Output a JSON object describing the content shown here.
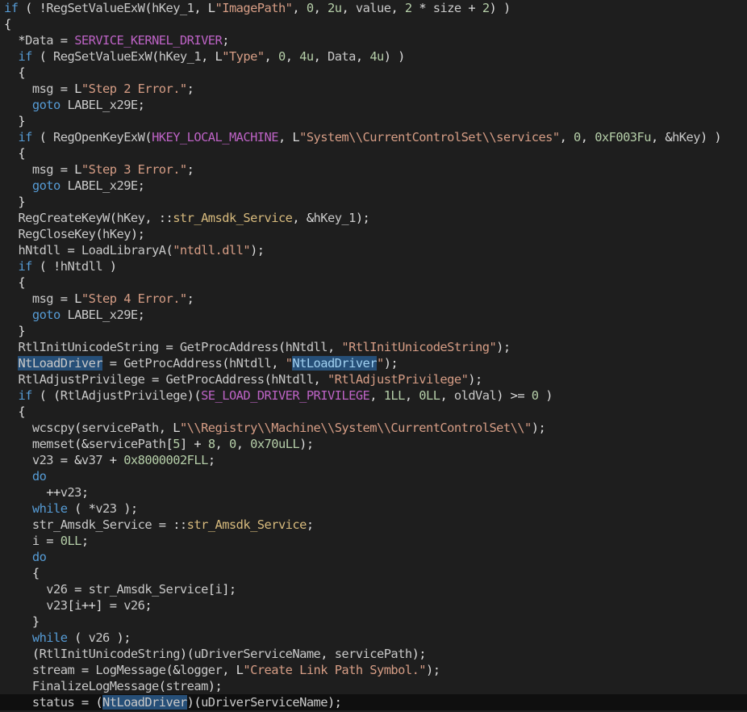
{
  "editor": {
    "name": "decompiled-pseudocode",
    "lines": [
      [
        [
          "if",
          "k"
        ],
        [
          " ( !",
          "t"
        ],
        [
          "RegSetValueExW",
          "f"
        ],
        [
          "(",
          "t"
        ],
        [
          "hKey_1",
          "v"
        ],
        [
          ", L",
          "t"
        ],
        [
          "\"ImagePath\"",
          "s"
        ],
        [
          ", ",
          "t"
        ],
        [
          "0",
          "n"
        ],
        [
          ", ",
          "t"
        ],
        [
          "2u",
          "n"
        ],
        [
          ", ",
          "t"
        ],
        [
          "value",
          "v"
        ],
        [
          ", ",
          "t"
        ],
        [
          "2",
          "n"
        ],
        [
          " * ",
          "t"
        ],
        [
          "size",
          "v"
        ],
        [
          " + ",
          "t"
        ],
        [
          "2",
          "n"
        ],
        [
          ") )",
          "t"
        ]
      ],
      [
        [
          "{",
          "t"
        ]
      ],
      [
        [
          "  *",
          "t"
        ],
        [
          "Data",
          "v"
        ],
        [
          " = ",
          "t"
        ],
        [
          "SERVICE_KERNEL_DRIVER",
          "m"
        ],
        [
          ";",
          "t"
        ]
      ],
      [
        [
          "  ",
          "t"
        ],
        [
          "if",
          "k"
        ],
        [
          " ( ",
          "t"
        ],
        [
          "RegSetValueExW",
          "f"
        ],
        [
          "(",
          "t"
        ],
        [
          "hKey_1",
          "v"
        ],
        [
          ", L",
          "t"
        ],
        [
          "\"Type\"",
          "s"
        ],
        [
          ", ",
          "t"
        ],
        [
          "0",
          "n"
        ],
        [
          ", ",
          "t"
        ],
        [
          "4u",
          "n"
        ],
        [
          ", ",
          "t"
        ],
        [
          "Data",
          "v"
        ],
        [
          ", ",
          "t"
        ],
        [
          "4u",
          "n"
        ],
        [
          ") )",
          "t"
        ]
      ],
      [
        [
          "  {",
          "t"
        ]
      ],
      [
        [
          "    ",
          "t"
        ],
        [
          "msg",
          "v"
        ],
        [
          " = L",
          "t"
        ],
        [
          "\"Step 2 Error.\"",
          "s"
        ],
        [
          ";",
          "t"
        ]
      ],
      [
        [
          "    ",
          "t"
        ],
        [
          "goto",
          "k"
        ],
        [
          " ",
          "t"
        ],
        [
          "LABEL_x29E",
          "l"
        ],
        [
          ";",
          "t"
        ]
      ],
      [
        [
          "  }",
          "t"
        ]
      ],
      [
        [
          "  ",
          "t"
        ],
        [
          "if",
          "k"
        ],
        [
          " ( ",
          "t"
        ],
        [
          "RegOpenKeyExW",
          "f"
        ],
        [
          "(",
          "t"
        ],
        [
          "HKEY_LOCAL_MACHINE",
          "m"
        ],
        [
          ", L",
          "t"
        ],
        [
          "\"System\\\\CurrentControlSet\\\\services\"",
          "s"
        ],
        [
          ", ",
          "t"
        ],
        [
          "0",
          "n"
        ],
        [
          ", ",
          "t"
        ],
        [
          "0xF003Fu",
          "n"
        ],
        [
          ", &",
          "t"
        ],
        [
          "hKey",
          "v"
        ],
        [
          ") )",
          "t"
        ]
      ],
      [
        [
          "  {",
          "t"
        ]
      ],
      [
        [
          "    ",
          "t"
        ],
        [
          "msg",
          "v"
        ],
        [
          " = L",
          "t"
        ],
        [
          "\"Step 3 Error.\"",
          "s"
        ],
        [
          ";",
          "t"
        ]
      ],
      [
        [
          "    ",
          "t"
        ],
        [
          "goto",
          "k"
        ],
        [
          " ",
          "t"
        ],
        [
          "LABEL_x29E",
          "l"
        ],
        [
          ";",
          "t"
        ]
      ],
      [
        [
          "  }",
          "t"
        ]
      ],
      [
        [
          "  ",
          "t"
        ],
        [
          "RegCreateKeyW",
          "f"
        ],
        [
          "(",
          "t"
        ],
        [
          "hKey",
          "v"
        ],
        [
          ", ::",
          "t"
        ],
        [
          "str_Amsdk_Service",
          "g"
        ],
        [
          ", &",
          "t"
        ],
        [
          "hKey_1",
          "v"
        ],
        [
          ");",
          "t"
        ]
      ],
      [
        [
          "  ",
          "t"
        ],
        [
          "RegCloseKey",
          "f"
        ],
        [
          "(",
          "t"
        ],
        [
          "hKey",
          "v"
        ],
        [
          ");",
          "t"
        ]
      ],
      [
        [
          "  ",
          "t"
        ],
        [
          "hNtdll",
          "v"
        ],
        [
          " = ",
          "t"
        ],
        [
          "LoadLibraryA",
          "f"
        ],
        [
          "(",
          "t"
        ],
        [
          "\"ntdll.dll\"",
          "s"
        ],
        [
          ");",
          "t"
        ]
      ],
      [
        [
          "  ",
          "t"
        ],
        [
          "if",
          "k"
        ],
        [
          " ( !",
          "t"
        ],
        [
          "hNtdll",
          "v"
        ],
        [
          " )",
          "t"
        ]
      ],
      [
        [
          "  {",
          "t"
        ]
      ],
      [
        [
          "    ",
          "t"
        ],
        [
          "msg",
          "v"
        ],
        [
          " = L",
          "t"
        ],
        [
          "\"Step 4 Error.\"",
          "s"
        ],
        [
          ";",
          "t"
        ]
      ],
      [
        [
          "    ",
          "t"
        ],
        [
          "goto",
          "k"
        ],
        [
          " ",
          "t"
        ],
        [
          "LABEL_x29E",
          "l"
        ],
        [
          ";",
          "t"
        ]
      ],
      [
        [
          "  }",
          "t"
        ]
      ],
      [
        [
          "  ",
          "t"
        ],
        [
          "RtlInitUnicodeString",
          "v"
        ],
        [
          " = ",
          "t"
        ],
        [
          "GetProcAddress",
          "f"
        ],
        [
          "(",
          "t"
        ],
        [
          "hNtdll",
          "v"
        ],
        [
          ", ",
          "t"
        ],
        [
          "\"RtlInitUnicodeString\"",
          "s"
        ],
        [
          ");",
          "t"
        ]
      ],
      [
        [
          "  ",
          "t"
        ],
        [
          "NtLoadDriver",
          "v",
          "hl"
        ],
        [
          " = ",
          "t"
        ],
        [
          "GetProcAddress",
          "f"
        ],
        [
          "(",
          "t"
        ],
        [
          "hNtdll",
          "v"
        ],
        [
          ", ",
          "t"
        ],
        [
          "\"",
          "s"
        ],
        [
          "NtLoadDriver",
          "sf",
          "hl"
        ],
        [
          "\"",
          "s"
        ],
        [
          ");",
          "t"
        ]
      ],
      [
        [
          "  ",
          "t"
        ],
        [
          "RtlAdjustPrivilege",
          "v"
        ],
        [
          " = ",
          "t"
        ],
        [
          "GetProcAddress",
          "f"
        ],
        [
          "(",
          "t"
        ],
        [
          "hNtdll",
          "v"
        ],
        [
          ", ",
          "t"
        ],
        [
          "\"RtlAdjustPrivilege\"",
          "s"
        ],
        [
          ");",
          "t"
        ]
      ],
      [
        [
          "  ",
          "t"
        ],
        [
          "if",
          "k"
        ],
        [
          " ( (",
          "t"
        ],
        [
          "RtlAdjustPrivilege",
          "v"
        ],
        [
          ")(",
          "t"
        ],
        [
          "SE_LOAD_DRIVER_PRIVILEGE",
          "m"
        ],
        [
          ", ",
          "t"
        ],
        [
          "1LL",
          "n"
        ],
        [
          ", ",
          "t"
        ],
        [
          "0LL",
          "n"
        ],
        [
          ", ",
          "t"
        ],
        [
          "oldVal",
          "v"
        ],
        [
          ") >= ",
          "t"
        ],
        [
          "0",
          "n"
        ],
        [
          " )",
          "t"
        ]
      ],
      [
        [
          "  {",
          "t"
        ]
      ],
      [
        [
          "    ",
          "t"
        ],
        [
          "wcscpy",
          "f"
        ],
        [
          "(",
          "t"
        ],
        [
          "servicePath",
          "v"
        ],
        [
          ", L",
          "t"
        ],
        [
          "\"\\\\Registry\\\\Machine\\\\System\\\\CurrentControlSet\\\\\"",
          "s"
        ],
        [
          ");",
          "t"
        ]
      ],
      [
        [
          "    ",
          "t"
        ],
        [
          "memset",
          "f"
        ],
        [
          "(&",
          "t"
        ],
        [
          "servicePath",
          "v"
        ],
        [
          "[",
          "t"
        ],
        [
          "5",
          "n"
        ],
        [
          "] + ",
          "t"
        ],
        [
          "8",
          "n"
        ],
        [
          ", ",
          "t"
        ],
        [
          "0",
          "n"
        ],
        [
          ", ",
          "t"
        ],
        [
          "0x70uLL",
          "n"
        ],
        [
          ");",
          "t"
        ]
      ],
      [
        [
          "    ",
          "t"
        ],
        [
          "v23",
          "v"
        ],
        [
          " = &",
          "t"
        ],
        [
          "v37",
          "v"
        ],
        [
          " + ",
          "t"
        ],
        [
          "0x8000002FLL",
          "n"
        ],
        [
          ";",
          "t"
        ]
      ],
      [
        [
          "    ",
          "t"
        ],
        [
          "do",
          "k"
        ]
      ],
      [
        [
          "      ++",
          "t"
        ],
        [
          "v23",
          "v"
        ],
        [
          ";",
          "t"
        ]
      ],
      [
        [
          "    ",
          "t"
        ],
        [
          "while",
          "k"
        ],
        [
          " ( *",
          "t"
        ],
        [
          "v23",
          "v"
        ],
        [
          " );",
          "t"
        ]
      ],
      [
        [
          "    ",
          "t"
        ],
        [
          "str_Amsdk_Service",
          "v"
        ],
        [
          " = ::",
          "t"
        ],
        [
          "str_Amsdk_Service",
          "g"
        ],
        [
          ";",
          "t"
        ]
      ],
      [
        [
          "    ",
          "t"
        ],
        [
          "i",
          "v"
        ],
        [
          " = ",
          "t"
        ],
        [
          "0LL",
          "n"
        ],
        [
          ";",
          "t"
        ]
      ],
      [
        [
          "    ",
          "t"
        ],
        [
          "do",
          "k"
        ]
      ],
      [
        [
          "    {",
          "t"
        ]
      ],
      [
        [
          "      ",
          "t"
        ],
        [
          "v26",
          "v"
        ],
        [
          " = ",
          "t"
        ],
        [
          "str_Amsdk_Service",
          "v"
        ],
        [
          "[",
          "t"
        ],
        [
          "i",
          "v"
        ],
        [
          "];",
          "t"
        ]
      ],
      [
        [
          "      ",
          "t"
        ],
        [
          "v23",
          "v"
        ],
        [
          "[",
          "t"
        ],
        [
          "i",
          "v"
        ],
        [
          "++] = ",
          "t"
        ],
        [
          "v26",
          "v"
        ],
        [
          ";",
          "t"
        ]
      ],
      [
        [
          "    }",
          "t"
        ]
      ],
      [
        [
          "    ",
          "t"
        ],
        [
          "while",
          "k"
        ],
        [
          " ( ",
          "t"
        ],
        [
          "v26",
          "v"
        ],
        [
          " );",
          "t"
        ]
      ],
      [
        [
          "    (",
          "t"
        ],
        [
          "RtlInitUnicodeString",
          "v"
        ],
        [
          ")(",
          "t"
        ],
        [
          "uDriverServiceName",
          "v"
        ],
        [
          ", ",
          "t"
        ],
        [
          "servicePath",
          "v"
        ],
        [
          ");",
          "t"
        ]
      ],
      [
        [
          "    ",
          "t"
        ],
        [
          "stream",
          "v"
        ],
        [
          " = ",
          "t"
        ],
        [
          "LogMessage",
          "f"
        ],
        [
          "(&",
          "t"
        ],
        [
          "logger",
          "v"
        ],
        [
          ", L",
          "t"
        ],
        [
          "\"Create Link Path Symbol.\"",
          "s"
        ],
        [
          ");",
          "t"
        ]
      ],
      [
        [
          "    ",
          "t"
        ],
        [
          "FinalizeLogMessage",
          "f"
        ],
        [
          "(",
          "t"
        ],
        [
          "stream",
          "v"
        ],
        [
          ");",
          "t"
        ]
      ],
      [
        [
          "    ",
          "t"
        ],
        [
          "status",
          "v"
        ],
        [
          " = (",
          "t"
        ],
        [
          "NtLoadDriver",
          "v",
          "hl"
        ],
        [
          ")(",
          "t"
        ],
        [
          "uDriverServiceName",
          "v"
        ],
        [
          ");",
          "t"
        ]
      ]
    ]
  }
}
